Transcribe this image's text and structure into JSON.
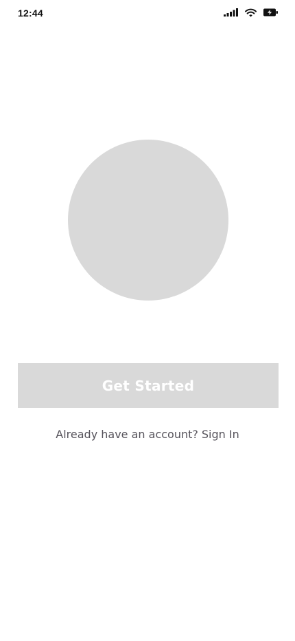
{
  "status_bar": {
    "time": "12:44",
    "icons": [
      "cellular-signal-icon",
      "wifi-icon",
      "battery-charging-icon"
    ]
  },
  "onboarding": {
    "primary_button_label": "Get Started",
    "account_prompt": "Already have an account?",
    "sign_in_link": "Sign In"
  },
  "colors": {
    "placeholder_gray": "#d9d9d9",
    "button_text": "#ffffff",
    "prompt_text": "#55525a"
  }
}
